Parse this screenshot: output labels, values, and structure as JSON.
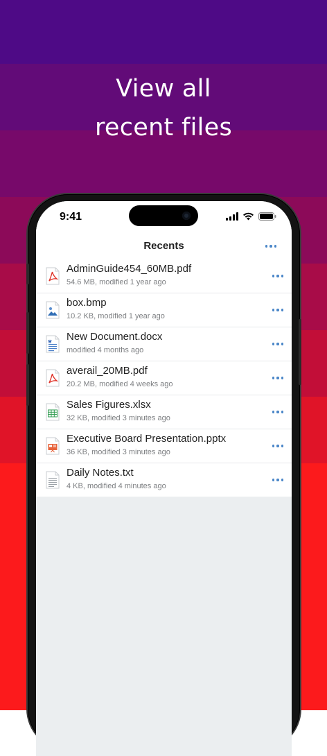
{
  "background_bands": [
    "#4e0a86",
    "#620b78",
    "#77096a",
    "#8c0a59",
    "#a80c48",
    "#c20e38",
    "#e01428",
    "#fa1a1e",
    "#ff1818",
    "#ff1818",
    "#ff1818"
  ],
  "headline": {
    "line1": "View all",
    "line2": "recent files"
  },
  "status_bar": {
    "time": "9:41"
  },
  "nav": {
    "title": "Recents"
  },
  "accent_color": "#4a86c8",
  "files": [
    {
      "name": "AdminGuide454_60MB.pdf",
      "meta": "54.6 MB, modified 1 year ago",
      "icon": "pdf-icon"
    },
    {
      "name": "box.bmp",
      "meta": "10.2 KB, modified 1 year ago",
      "icon": "image-icon"
    },
    {
      "name": "New Document.docx",
      "meta": "modified 4 months ago",
      "icon": "word-doc-icon"
    },
    {
      "name": "averail_20MB.pdf",
      "meta": "20.2 MB, modified 4 weeks ago",
      "icon": "pdf-icon"
    },
    {
      "name": "Sales Figures.xlsx",
      "meta": "32 KB, modified 3 minutes ago",
      "icon": "spreadsheet-icon"
    },
    {
      "name": "Executive Board Presentation.pptx",
      "meta": "36 KB, modified 3 minutes ago",
      "icon": "presentation-icon"
    },
    {
      "name": "Daily Notes.txt",
      "meta": "4 KB, modified 4 minutes ago",
      "icon": "text-file-icon"
    }
  ]
}
